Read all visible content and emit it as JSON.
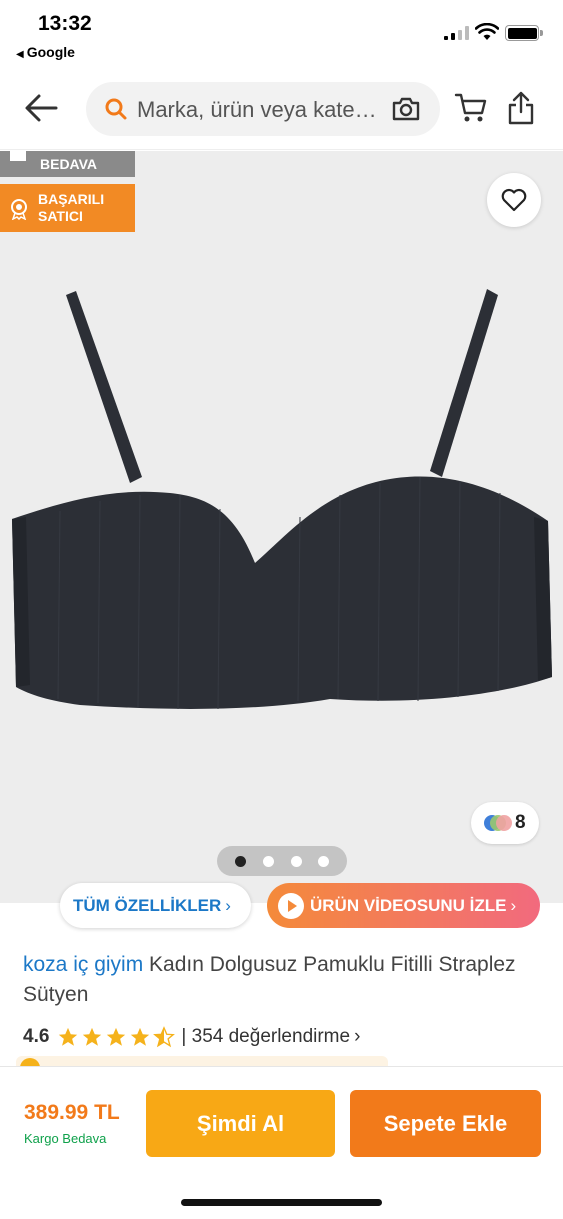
{
  "status_bar": {
    "time": "13:32",
    "back_app": "Google",
    "back_icon": "left-triangle-icon",
    "icons": [
      "signal-icon",
      "wifi-icon",
      "battery-icon"
    ]
  },
  "header": {
    "back_icon": "back-arrow-icon",
    "search_placeholder": "Marka, ürün veya kate…",
    "search_icon": "search-icon",
    "camera_icon": "camera-icon",
    "cart_icon": "cart-icon",
    "share_icon": "share-icon"
  },
  "gallery": {
    "badges": [
      {
        "label": "BEDAVA",
        "icon": "book-icon"
      },
      {
        "label": "BAŞARILI SATICI",
        "icon": "award-icon"
      }
    ],
    "favorite_icon": "heart-icon",
    "color_variants_count": "8",
    "pager": {
      "total": 4,
      "active": 0
    }
  },
  "chips": {
    "specs": "TÜM ÖZELLİKLER",
    "video": "ÜRÜN VİDEOSUNU İZLE"
  },
  "product": {
    "brand": "koza iç giyim",
    "name": " Kadın Dolgusuz Pamuklu Fitilli Straplez Sütyen",
    "rating": "4.6",
    "stars": 4.6,
    "reviews": "| 354 değerlendirme"
  },
  "bottom_bar": {
    "price": "389.99 TL",
    "shipping": "Kargo Bedava",
    "buy_now": "Şimdi Al",
    "add_to_cart": "Sepete Ekle"
  },
  "colors": {
    "accent": "#f27a1a",
    "buy": "#f8a815",
    "link": "#1c78c7",
    "green": "#0fa14b",
    "star": "#f5b21b"
  }
}
